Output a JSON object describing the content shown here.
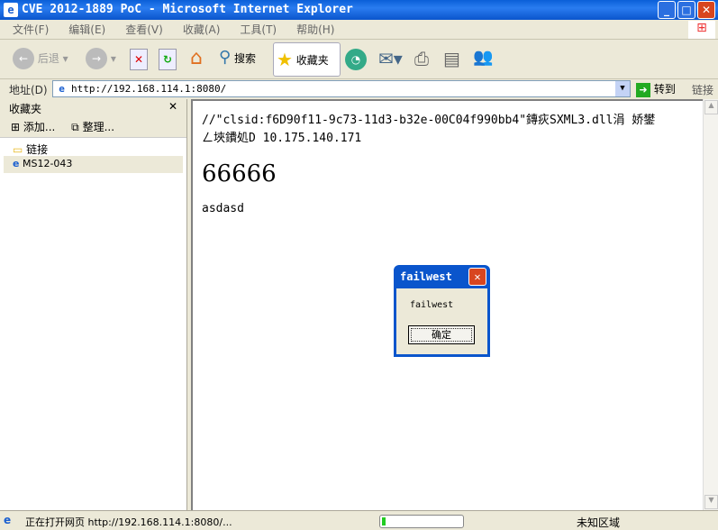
{
  "window": {
    "title": "CVE 2012-1889 PoC - Microsoft Internet Explorer"
  },
  "menu": [
    "文件(F)",
    "编辑(E)",
    "查看(V)",
    "收藏(A)",
    "工具(T)",
    "帮助(H)"
  ],
  "toolbar": {
    "back": "后退",
    "search": "搜索",
    "favorites": "收藏夹"
  },
  "address": {
    "label": "地址(D)",
    "url": "http://192.168.114.1:8080/",
    "go": "转到",
    "links": "链接"
  },
  "sidebar": {
    "title": "收藏夹",
    "add": "添加...",
    "organize": "整理...",
    "items": [
      "链接",
      "MS12-043"
    ]
  },
  "page": {
    "line1": "//\"clsid:f6D90f11-9c73-11d3-b32e-00C04f990bb4\"鏄疢SXML3.dll涓  娇鐢",
    "line2": "ㄥ埉鐨処D  10.175.140.171",
    "heading": "66666",
    "text": "asdasd"
  },
  "dialog": {
    "title": "failwest",
    "message": "failwest",
    "ok": "确定"
  },
  "status": {
    "text": "正在打开网页 http://192.168.114.1:8080/...",
    "zone": "未知区域",
    "progress": 0.05
  }
}
